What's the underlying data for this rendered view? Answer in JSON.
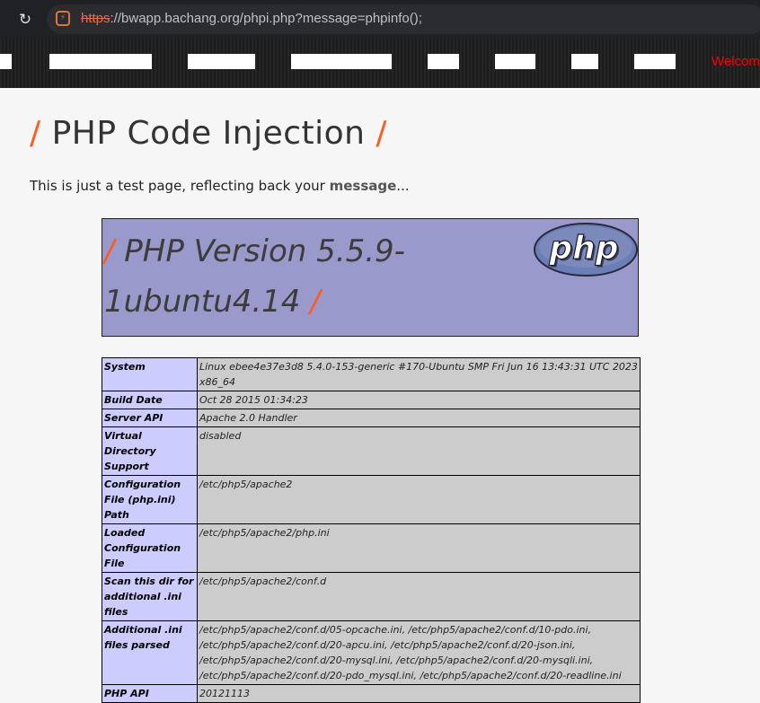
{
  "browser": {
    "url_scheme": "https",
    "url_rest": "://bwapp.bachang.org/phpi.php?message=phpinfo();",
    "reload_icon": "reload-icon",
    "site_icon": "site-info-icon"
  },
  "menubar": {
    "welcome_text": "Welcome"
  },
  "page": {
    "title": "PHP Code Injection",
    "intro_prefix": "This is just a test page, reflecting back your ",
    "intro_bold": "message",
    "intro_suffix": "..."
  },
  "phpinfo": {
    "version_heading": "PHP Version 5.5.9-1ubuntu4.14",
    "logo_text": "php",
    "rows": [
      {
        "key": "System",
        "value": "Linux ebee4e37e3d8 5.4.0-153-generic #170-Ubuntu SMP Fri Jun 16 13:43:31 UTC 2023 x86_64"
      },
      {
        "key": "Build Date",
        "value": "Oct 28 2015 01:34:23"
      },
      {
        "key": "Server API",
        "value": "Apache 2.0 Handler"
      },
      {
        "key": "Virtual Directory Support",
        "value": "disabled"
      },
      {
        "key": "Configuration File (php.ini) Path",
        "value": "/etc/php5/apache2"
      },
      {
        "key": "Loaded Configuration File",
        "value": "/etc/php5/apache2/php.ini"
      },
      {
        "key": "Scan this dir for additional .ini files",
        "value": "/etc/php5/apache2/conf.d"
      },
      {
        "key": "Additional .ini files parsed",
        "value": "/etc/php5/apache2/conf.d/05-opcache.ini, /etc/php5/apache2/conf.d/10-pdo.ini, /etc/php5/apache2/conf.d/20-apcu.ini, /etc/php5/apache2/conf.d/20-json.ini, /etc/php5/apache2/conf.d/20-mysql.ini, /etc/php5/apache2/conf.d/20-mysqli.ini, /etc/php5/apache2/conf.d/20-pdo_mysql.ini, /etc/php5/apache2/conf.d/20-readline.ini"
      },
      {
        "key": "PHP API",
        "value": "20121113"
      }
    ]
  },
  "colors": {
    "accent_slash": "#ff5a1f",
    "phpinfo_header": "#9999cc",
    "key_cell": "#ccccff",
    "value_cell": "#cccccc",
    "welcome": "#ff0000"
  }
}
